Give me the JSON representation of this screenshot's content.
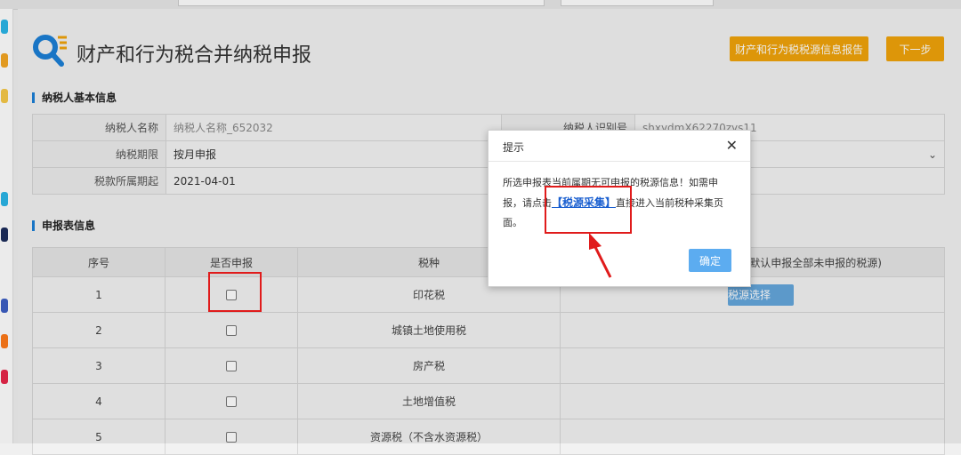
{
  "page": {
    "title": "财产和行为税合并纳税申报",
    "report_button": "财产和行为税税源信息报告",
    "next_button": "下一步"
  },
  "taxpayer_info": {
    "section_title": "纳税人基本信息",
    "name_label": "纳税人名称",
    "name_value": "纳税人名称_652032",
    "id_label": "纳税人识别号",
    "id_value": "shxydmX62270zys11",
    "period_label": "纳税期限",
    "period_value": "按月申报",
    "start_label": "税款所属期起",
    "start_value": "2021-04-01"
  },
  "declaration": {
    "section_title": "申报表信息",
    "headers": {
      "seq": "序号",
      "declare": "是否申报",
      "tax": "税种",
      "source": "(默认申报全部未申报的税源)"
    },
    "source_button": "税源选择",
    "rows": [
      {
        "seq": "1",
        "tax": "印花税"
      },
      {
        "seq": "2",
        "tax": "城镇土地使用税"
      },
      {
        "seq": "3",
        "tax": "房产税"
      },
      {
        "seq": "4",
        "tax": "土地增值税"
      },
      {
        "seq": "5",
        "tax": "资源税（不含水资源税）"
      }
    ]
  },
  "dialog": {
    "title": "提示",
    "body_before": "所选申报表当前属期无可申报的税源信息！如需申报，请点击",
    "link_text": "【税源采集】",
    "body_after": "直接进入当前税种采集页面。",
    "ok_button": "确定"
  },
  "colors": {
    "accent_orange": "#f0a30a",
    "accent_blue": "#1c7fd6",
    "annotation_red": "#e01b1b"
  }
}
